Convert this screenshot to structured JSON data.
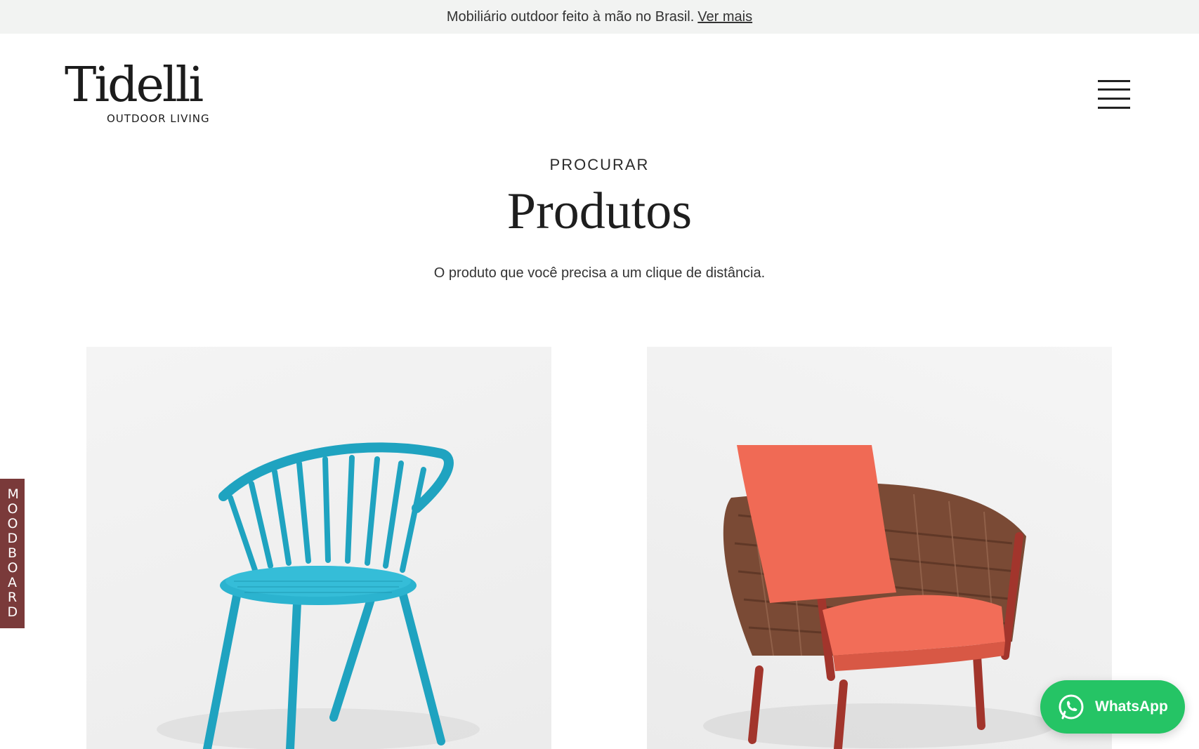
{
  "announcement": {
    "text": "Mobiliário outdoor feito à mão no Brasil.",
    "link": "Ver mais"
  },
  "brand": {
    "name": "Tidelli",
    "tagline": "OUTDOOR LIVING"
  },
  "hero": {
    "kicker": "PROCURAR",
    "title": "Produtos",
    "subtitle": "O produto que você precisa a um clique de distância."
  },
  "products": [
    {
      "image": "blue-chair",
      "color": "#1fa3c0"
    },
    {
      "image": "coral-cushion-armchair",
      "color": "#f06a55"
    }
  ],
  "moodboard": {
    "label": "MOODBOARD",
    "color": "#7a3a3a"
  },
  "whatsapp": {
    "label": "WhatsApp",
    "color": "#25c465"
  },
  "icons": {
    "menu": "hamburger-icon",
    "whatsapp": "whatsapp-icon"
  }
}
